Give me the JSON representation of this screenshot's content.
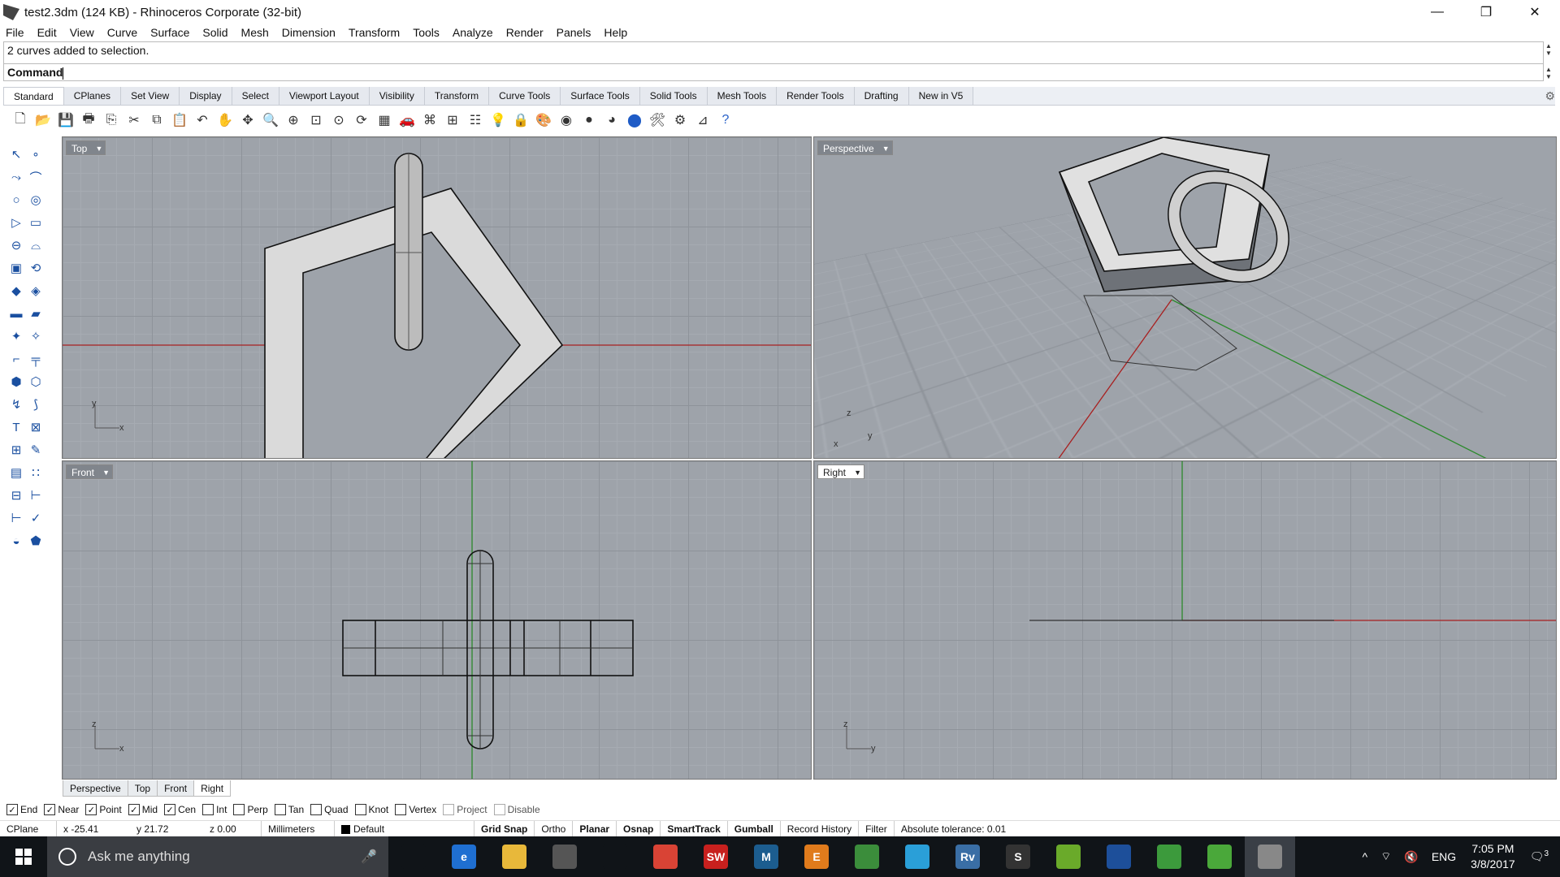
{
  "window": {
    "title": "test2.3dm (124 KB) - Rhinoceros Corporate (32-bit)",
    "minimize": "—",
    "restore": "❐",
    "close": "✕"
  },
  "menu": [
    "File",
    "Edit",
    "View",
    "Curve",
    "Surface",
    "Solid",
    "Mesh",
    "Dimension",
    "Transform",
    "Tools",
    "Analyze",
    "Render",
    "Panels",
    "Help"
  ],
  "command": {
    "history": "2 curves added to selection.",
    "prompt": "Command"
  },
  "tabs": [
    "Standard",
    "CPlanes",
    "Set View",
    "Display",
    "Select",
    "Viewport Layout",
    "Visibility",
    "Transform",
    "Curve Tools",
    "Surface Tools",
    "Solid Tools",
    "Mesh Tools",
    "Render Tools",
    "Drafting",
    "New in V5"
  ],
  "active_tab": "Standard",
  "toolbar_icons": [
    "new-icon",
    "open-icon",
    "save-icon",
    "print-icon",
    "import-icon",
    "cut-icon",
    "copy-icon",
    "paste-icon",
    "undo-icon",
    "pan-icon",
    "move-view-icon",
    "zoom-icon",
    "zoom-window-icon",
    "zoom-extents-icon",
    "zoom-selected-icon",
    "rotate-view-icon",
    "four-views-icon",
    "car-icon",
    "mesh-icon",
    "cplane-icon",
    "properties-icon",
    "light-icon",
    "lock-icon",
    "render-icon",
    "color-wheel-icon",
    "shaded-sphere-icon",
    "rendered-sphere-icon",
    "blue-sphere-icon",
    "tools-icon",
    "options-icon",
    "dimension-icon",
    "help-icon"
  ],
  "viewports": {
    "top": {
      "label": "Top",
      "axis_a": "y",
      "axis_b": "x"
    },
    "perspective": {
      "label": "Perspective",
      "axis_a": "z",
      "axis_b": "y",
      "axis_c": "x"
    },
    "front": {
      "label": "Front",
      "axis_a": "z",
      "axis_b": "x"
    },
    "right": {
      "label": "Right",
      "axis_a": "z",
      "axis_b": "y"
    }
  },
  "viewport_tabs": [
    "Perspective",
    "Top",
    "Front",
    "Right"
  ],
  "active_viewport_tab": "Right",
  "osnaps": [
    {
      "label": "End",
      "checked": true
    },
    {
      "label": "Near",
      "checked": true
    },
    {
      "label": "Point",
      "checked": true
    },
    {
      "label": "Mid",
      "checked": true
    },
    {
      "label": "Cen",
      "checked": true
    },
    {
      "label": "Int",
      "checked": false
    },
    {
      "label": "Perp",
      "checked": false
    },
    {
      "label": "Tan",
      "checked": false
    },
    {
      "label": "Quad",
      "checked": false
    },
    {
      "label": "Knot",
      "checked": false
    },
    {
      "label": "Vertex",
      "checked": false
    },
    {
      "label": "Project",
      "checked": false,
      "disabled": true
    },
    {
      "label": "Disable",
      "checked": false,
      "disabled": true
    }
  ],
  "status": {
    "cplane": "CPlane",
    "x": "x -25.41",
    "y": "y 21.72",
    "z": "z 0.00",
    "units": "Millimeters",
    "layer": "Default",
    "grid_snap": "Grid Snap",
    "ortho": "Ortho",
    "planar": "Planar",
    "osnap": "Osnap",
    "smarttrack": "SmartTrack",
    "gumball": "Gumball",
    "record_history": "Record History",
    "filter": "Filter",
    "tolerance": "Absolute tolerance: 0.01"
  },
  "taskbar": {
    "search_placeholder": "Ask me anything",
    "apps": [
      {
        "name": "task-view-icon",
        "label": "",
        "color": "#101418"
      },
      {
        "name": "edge-icon",
        "label": "e",
        "color": "#1f6fd1"
      },
      {
        "name": "file-explorer-icon",
        "label": "",
        "color": "#e8b83a"
      },
      {
        "name": "store-icon",
        "label": "",
        "color": "#555"
      },
      {
        "name": "dropbox-icon",
        "label": "",
        "color": "#101418"
      },
      {
        "name": "chrome-icon",
        "label": "",
        "color": "#d94335"
      },
      {
        "name": "solidworks-icon",
        "label": "SW",
        "color": "#c8201e"
      },
      {
        "name": "app-3dsmax-icon",
        "label": "M",
        "color": "#1c5d8f"
      },
      {
        "name": "app-e-icon",
        "label": "E",
        "color": "#e07b1c"
      },
      {
        "name": "app-git-icon",
        "label": "",
        "color": "#3b8d3b"
      },
      {
        "name": "telegram-icon",
        "label": "",
        "color": "#2a9fd8"
      },
      {
        "name": "revit-icon",
        "label": "Rv",
        "color": "#3a6ea5"
      },
      {
        "name": "sketchbook-icon",
        "label": "S",
        "color": "#333"
      },
      {
        "name": "utorrent-icon",
        "label": "",
        "color": "#6aaa2a"
      },
      {
        "name": "app-globe-icon",
        "label": "",
        "color": "#1d4f9a"
      },
      {
        "name": "app-sheet-icon",
        "label": "",
        "color": "#3c9a3c"
      },
      {
        "name": "app-sheet2-icon",
        "label": "",
        "color": "#4aa83a"
      },
      {
        "name": "rhino-icon",
        "label": "",
        "color": "#888"
      }
    ],
    "lang": "ENG",
    "time": "7:05 PM",
    "date": "3/8/2017",
    "notifications": "3"
  }
}
